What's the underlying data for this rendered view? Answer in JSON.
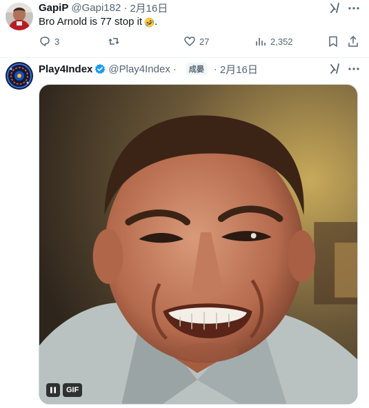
{
  "tweet1": {
    "name": "GapiP",
    "handle": "@Gapi182",
    "separator": "·",
    "date": "2月16日",
    "text": "Bro Arnold is 77 stop it",
    "text_end": ".",
    "emoji": "rolling-on-floor-laughing-emoji",
    "actions": {
      "replies": "3",
      "reposts": "",
      "likes": "27",
      "views": "2,352"
    }
  },
  "tweet2": {
    "name": "Play4Index",
    "handle": "@Play4Index",
    "separator": "·",
    "badge": "成晏",
    "separator2": "·",
    "date": "2月16日",
    "media": {
      "type": "GIF",
      "gif_label": "GIF"
    }
  },
  "colors": {
    "text": "#0f1419",
    "muted": "#536471",
    "verified": "#1d9bf0",
    "border": "#eff3f4"
  }
}
